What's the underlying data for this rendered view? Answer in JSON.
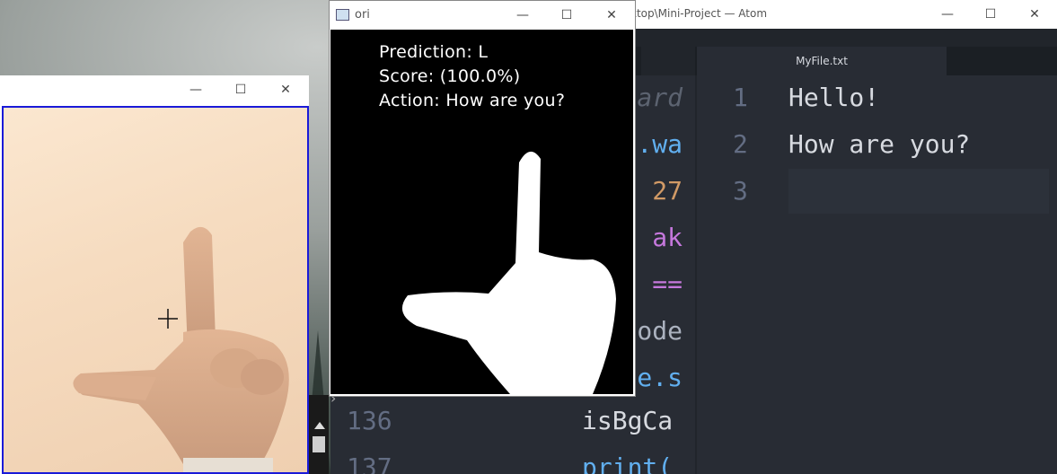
{
  "ori_window": {
    "title": "ori",
    "prediction_text": "Prediction: L",
    "score_text": "Score: (100.0%)",
    "action_text": "Action: How are you?"
  },
  "atom_window": {
    "title": "ktop\\Mini-Project — Atom",
    "tab_label": "MyFile.txt",
    "editor_lines": [
      {
        "num": "1",
        "text": "Hello!"
      },
      {
        "num": "2",
        "text": "How are you?"
      },
      {
        "num": "3",
        "text": ""
      }
    ],
    "background_code": [
      {
        "text": "ard",
        "color": "#5c6370"
      },
      {
        "text": ".wa",
        "color": "#61afef"
      },
      {
        "text": "27",
        "color": "#d19a66"
      },
      {
        "text": "ak",
        "color": "#c678dd"
      },
      {
        "text": "==",
        "color": "#c678dd"
      },
      {
        "text": "ode",
        "color": "#abb2bf"
      },
      {
        "text": "e.s",
        "color": "#61afef"
      }
    ],
    "bottom_code": [
      {
        "num": "136",
        "text": "isBgCa"
      },
      {
        "num": "137",
        "text": "print("
      }
    ]
  },
  "window_controls": {
    "minimize": "—",
    "maximize": "☐",
    "close": "✕"
  },
  "colors": {
    "cam_border": "#1a1ad8",
    "editor_bg": "#282c34"
  }
}
